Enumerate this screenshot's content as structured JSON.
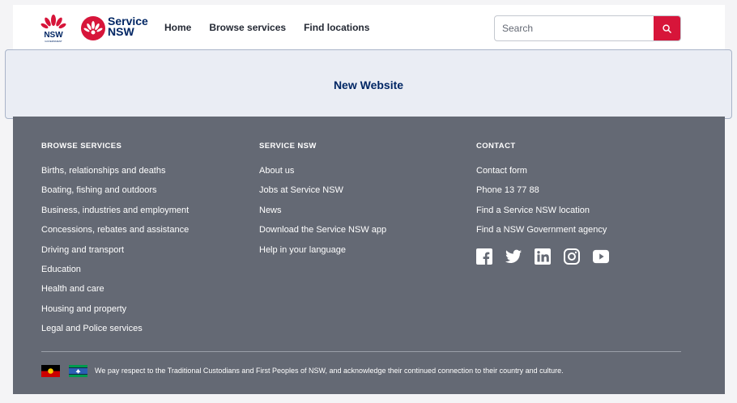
{
  "header": {
    "nsw_logo_text": "NSW",
    "nsw_logo_subtext": "GOVERNMENT",
    "service_logo_line1": "Service",
    "service_logo_line2": "NSW",
    "nav": [
      {
        "label": "Home"
      },
      {
        "label": "Browse services"
      },
      {
        "label": "Find locations"
      }
    ],
    "search_placeholder": "Search",
    "search_icon": "search-icon"
  },
  "banner": {
    "title": "New Website"
  },
  "footer": {
    "browse": {
      "heading": "BROWSE SERVICES",
      "items": [
        "Births, relationships and deaths",
        "Boating, fishing and outdoors",
        "Business, industries and employment",
        "Concessions, rebates and assistance",
        "Driving and transport",
        "Education",
        "Health and care",
        "Housing and property",
        "Legal and Police services"
      ]
    },
    "service": {
      "heading": "SERVICE NSW",
      "items": [
        "About us",
        "Jobs at Service NSW",
        "News",
        "Download the Service NSW app",
        "Help in your language"
      ]
    },
    "contact": {
      "heading": "CONTACT",
      "items": [
        "Contact form",
        "Phone 13 77 88",
        "Find a Service NSW location",
        "Find a NSW Government agency"
      ]
    },
    "socials": [
      "facebook-icon",
      "twitter-icon",
      "linkedin-icon",
      "instagram-icon",
      "youtube-icon"
    ],
    "acknowledgement": "We pay respect to the Traditional Custodians and First Peoples of NSW, and acknowledge their continued connection to their country and culture."
  },
  "colors": {
    "brand_navy": "#002664",
    "brand_red": "#d7153a",
    "footer_bg": "#646974",
    "banner_bg": "#eaedf4"
  }
}
